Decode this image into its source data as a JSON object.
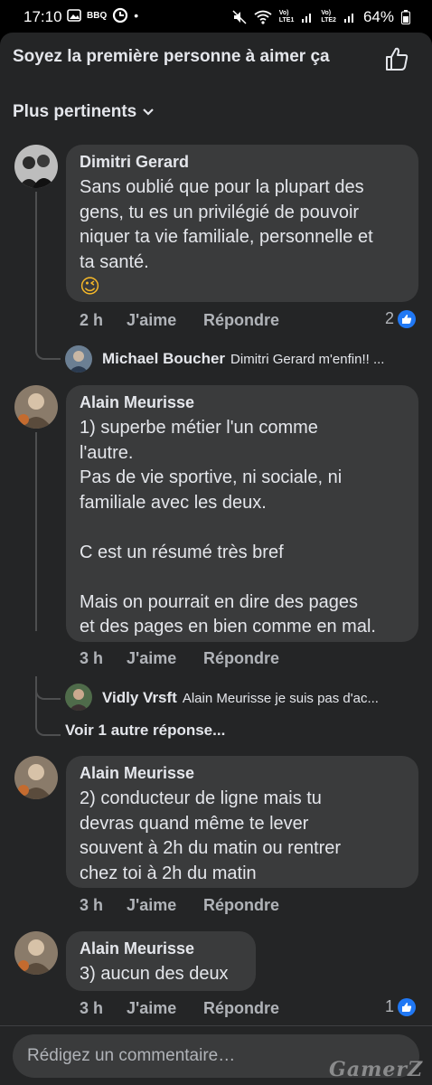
{
  "status_bar": {
    "time": "17:10",
    "battery": "64%",
    "sim1": "LTE1",
    "sim2": "LTE2",
    "volte": "Vo)"
  },
  "header": {
    "likes_prompt": "Soyez la première personne à aimer ça",
    "sort_label": "Plus pertinents"
  },
  "comments": [
    {
      "author": "Dimitri Gerard",
      "text": "Sans oublié que pour la plupart des\ngens, tu es un privilégié de pouvoir\nniquer ta vie familiale, personnelle et\nta santé.",
      "emoji": "😉",
      "time": "2 h",
      "like": "J'aime",
      "reply": "Répondre",
      "reactions": "2",
      "replies": [
        {
          "author": "Michael Boucher",
          "snippet": "Dimitri Gerard m'enfin!! ..."
        }
      ]
    },
    {
      "author": "Alain Meurisse",
      "text": "1) superbe métier l'un comme\nl'autre.\nPas de vie sportive, ni sociale, ni\nfamiliale avec les deux.\n\nC est un résumé très bref\n\nMais on pourrait en dire des pages\net des pages en bien comme en mal.",
      "time": "3 h",
      "like": "J'aime",
      "reply": "Répondre",
      "replies": [
        {
          "author": "Vidly Vrsft",
          "snippet": "Alain Meurisse je suis pas d'ac..."
        }
      ],
      "more_replies": "Voir 1 autre réponse..."
    },
    {
      "author": "Alain Meurisse",
      "text": "2) conducteur de ligne mais tu\ndevras quand même te lever\nsouvent à 2h du matin ou rentrer\nchez toi à 2h du matin",
      "time": "3 h",
      "like": "J'aime",
      "reply": "Répondre"
    },
    {
      "author": "Alain Meurisse",
      "text": "3) aucun des deux",
      "time": "3 h",
      "like": "J'aime",
      "reply": "Répondre",
      "reactions": "1"
    }
  ],
  "composer": {
    "placeholder": "Rédigez un commentaire…"
  },
  "watermark": "GamerZ",
  "colors": {
    "sheet": "#242526",
    "bubble": "#3a3b3c",
    "like_blue": "#2078f4",
    "muted": "#b0b3b8"
  }
}
